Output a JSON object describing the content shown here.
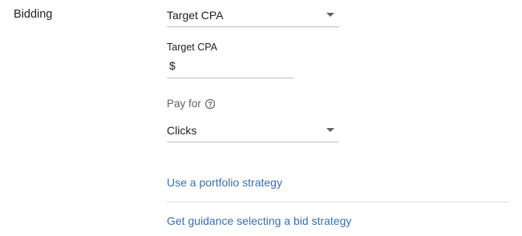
{
  "bidding": {
    "section_label": "Bidding",
    "strategy_select": {
      "value": "Target CPA"
    },
    "target_cpa": {
      "label": "Target CPA",
      "currency_prefix": "$",
      "value": ""
    },
    "pay_for": {
      "label": "Pay for",
      "help_icon": "help-circle-icon",
      "select_value": "Clicks"
    },
    "links": {
      "portfolio": "Use a portfolio strategy",
      "guidance": "Get guidance selecting a bid strategy"
    }
  },
  "colors": {
    "link": "#3a6fad",
    "underline": "#bdbdbd",
    "secondary_text": "#5f6368"
  }
}
